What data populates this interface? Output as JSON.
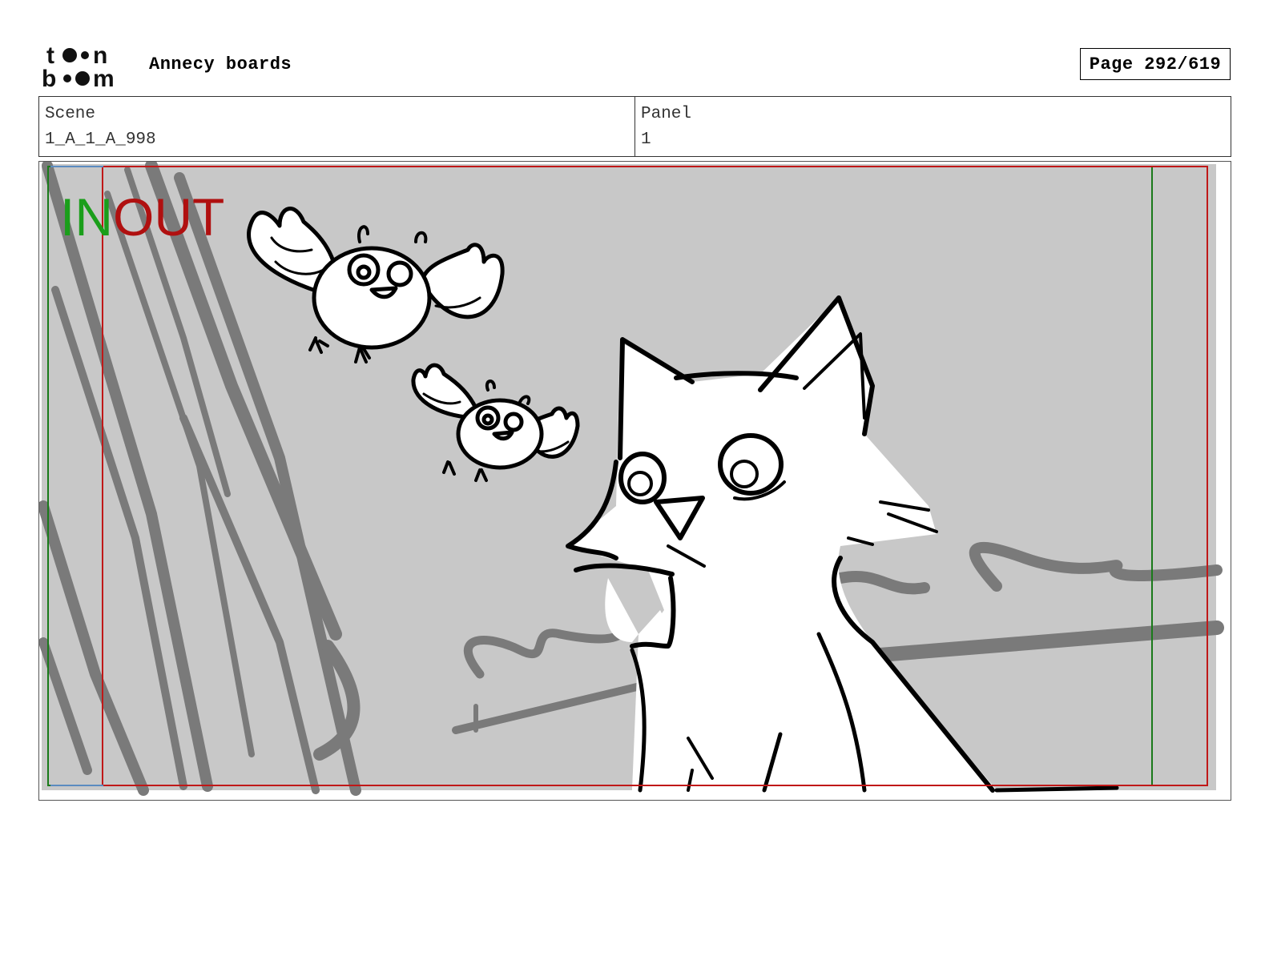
{
  "header": {
    "logo_text": "toon boom",
    "title": "Annecy boards",
    "page_label": "Page 292/619"
  },
  "info": {
    "scene_label": "Scene",
    "scene_value": "1_A_1_A_998",
    "panel_label": "Panel",
    "panel_value": "1"
  },
  "frame": {
    "in_marker": "IN",
    "out_marker": "OUT",
    "in_color": "#1a9e1a",
    "out_color": "#b01010",
    "background_color": "#c8c8c8"
  },
  "drawing": {
    "subjects": [
      "fox",
      "bird",
      "bird"
    ]
  }
}
